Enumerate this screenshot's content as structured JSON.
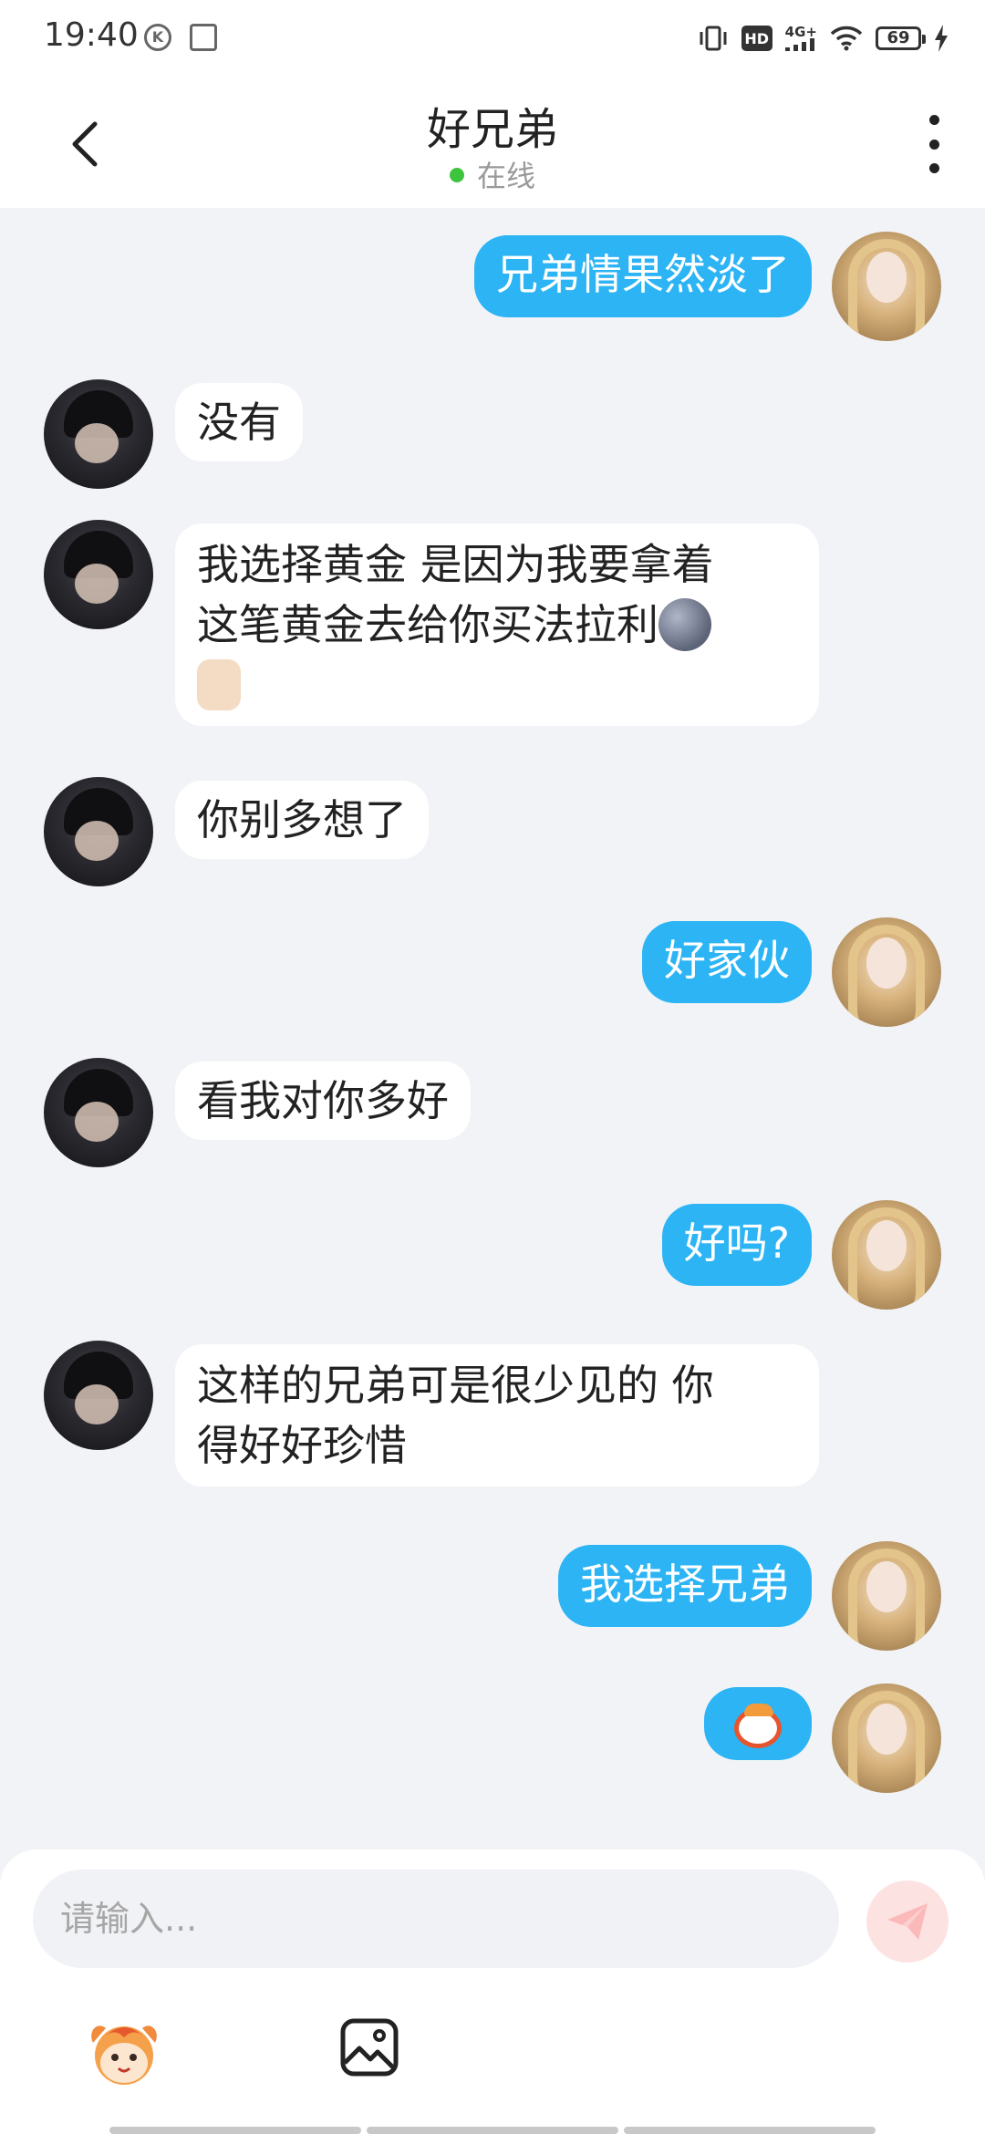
{
  "status_bar": {
    "time": "19:40",
    "network": "4G+",
    "hd": "HD",
    "battery": "69"
  },
  "header": {
    "title": "好兄弟",
    "status": "在线",
    "status_color": "#3dc43d"
  },
  "messages": [
    {
      "from": "me",
      "text": "兄弟情果然淡了"
    },
    {
      "from": "other",
      "text": "没有"
    },
    {
      "from": "other",
      "line1": "我选择黄金 是因为我要拿着",
      "line2": "这笔黄金去给你买法拉利",
      "emojis": [
        "full-moon-face-emoji",
        "thumbs-up-emoji"
      ]
    },
    {
      "from": "other",
      "text": "你别多想了"
    },
    {
      "from": "me",
      "text": "好家伙"
    },
    {
      "from": "other",
      "text": "看我对你多好"
    },
    {
      "from": "me",
      "text": "好吗?"
    },
    {
      "from": "other",
      "line1": "这样的兄弟可是很少见的 你",
      "line2": "得好好珍惜"
    },
    {
      "from": "me",
      "text": "我选择兄弟"
    },
    {
      "from": "me",
      "sticker": "laughing-monkey-sticker"
    }
  ],
  "input": {
    "placeholder": "请输入..."
  },
  "colors": {
    "my_bubble": "#2cb4f4",
    "other_bubble": "#ffffff",
    "background": "#f1f3f7"
  },
  "icons": {
    "back": "back-arrow-icon",
    "more": "more-vertical-icon",
    "send": "send-icon",
    "emoji": "emoji-sticker-icon",
    "image": "image-icon"
  }
}
